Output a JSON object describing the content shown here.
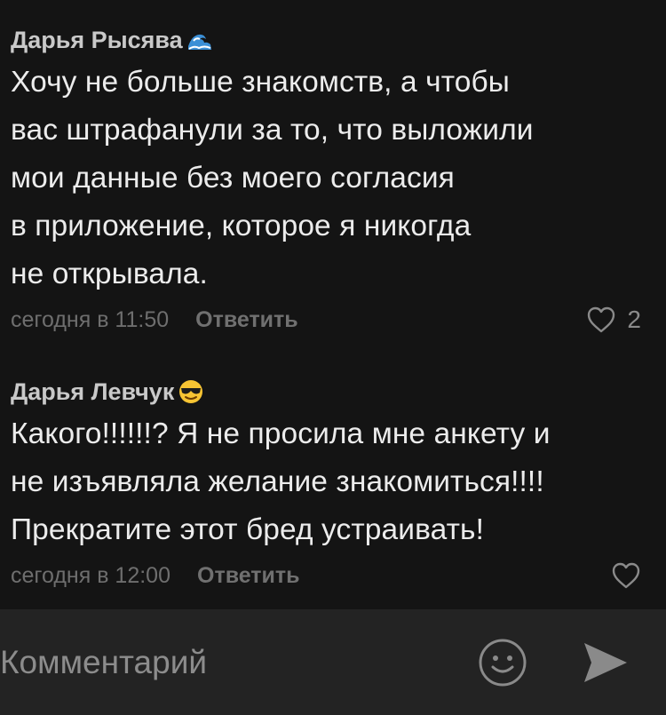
{
  "comments": [
    {
      "author": "Дарья Рысява",
      "author_emoji": "wave-emoji",
      "text": "Хочу не больше знакомств, а чтобы\nвас штрафанули за то, что выложили\nмои данные без моего согласия\nв приложение, которое я никогда\nне открывала.",
      "timestamp": "сегодня в 11:50",
      "reply_label": "Ответить",
      "like_icon": "heart-outline-icon",
      "likes": "2"
    },
    {
      "author": "Дарья Левчук",
      "author_emoji": "sunglasses-face-emoji",
      "text": "Какого!!!!!!? Я не просила мне анкету и\nне изъявляла желание знакомиться!!!!\nПрекратите этот бред устраивать!",
      "timestamp": "сегодня в 12:00",
      "reply_label": "Ответить",
      "like_icon": "heart-outline-icon"
    }
  ],
  "composer": {
    "placeholder": "Комментарий",
    "emoji_icon": "smiley-icon",
    "send_icon": "send-arrow-icon"
  },
  "colors": {
    "background": "#141414",
    "composer_background": "#232323",
    "text": "#ececec",
    "meta_text": "#6e6e6e"
  }
}
